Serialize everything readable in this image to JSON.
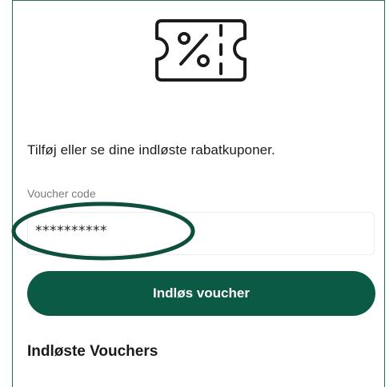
{
  "icon": {
    "name": "voucher-percent-icon"
  },
  "intro_text": "Tilføj eller se dine indløste rabatkuponer.",
  "voucher_field": {
    "label": "Voucher code",
    "value": "**********"
  },
  "redeem_button": {
    "label": "Indløs voucher"
  },
  "redeemed_section": {
    "title": "Indløste Vouchers"
  },
  "colors": {
    "primary": "#0b5a46",
    "highlight_ring": "#0f4f3d",
    "label": "#7a7a7a"
  }
}
